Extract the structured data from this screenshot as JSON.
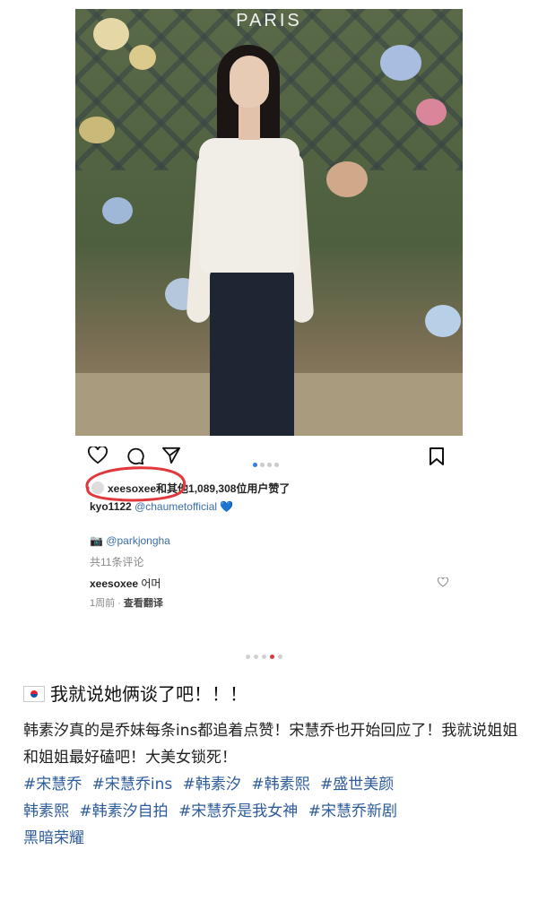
{
  "photo": {
    "brand_text": "PARIS"
  },
  "actions": {
    "like": "heart-icon",
    "comment": "comment-icon",
    "share": "send-icon",
    "save": "bookmark-icon",
    "carousel_page": 1,
    "carousel_total": 4
  },
  "likes": {
    "user": "xeesoxee",
    "rest": "和其他1,089,308位用户赞了"
  },
  "caption": {
    "user": "kyo1122",
    "mention": "@chaumetofficial",
    "heart": "💙"
  },
  "credit": {
    "camera": "📷",
    "mention": "@parkjongha"
  },
  "comments": {
    "count_label": "共11条评论",
    "comment_user": "xeesoxee",
    "comment_text": "어머",
    "time": "1周前",
    "separator": "·",
    "translate": "查看翻译"
  },
  "carousel": {
    "page": 4,
    "total": 5
  },
  "post": {
    "title": "我就说她俩谈了吧！！！",
    "body": "韩素汐真的是乔妹每条ins都追着点赞！宋慧乔也开始回应了！我就说姐姐和姐姐最好磕吧！大美女锁死！",
    "tags": [
      "#宋慧乔",
      "#宋慧乔ins",
      "#韩素汐",
      "#韩素熙",
      "#盛世美颜",
      "韩素熙",
      "#韩素汐自拍",
      "#宋慧乔是我女神",
      "#宋慧乔新剧",
      "黑暗荣耀"
    ]
  },
  "colors": {
    "accent": "#3b7bd6",
    "annotation": "#e0383d",
    "tag": "#2e5c9a"
  }
}
